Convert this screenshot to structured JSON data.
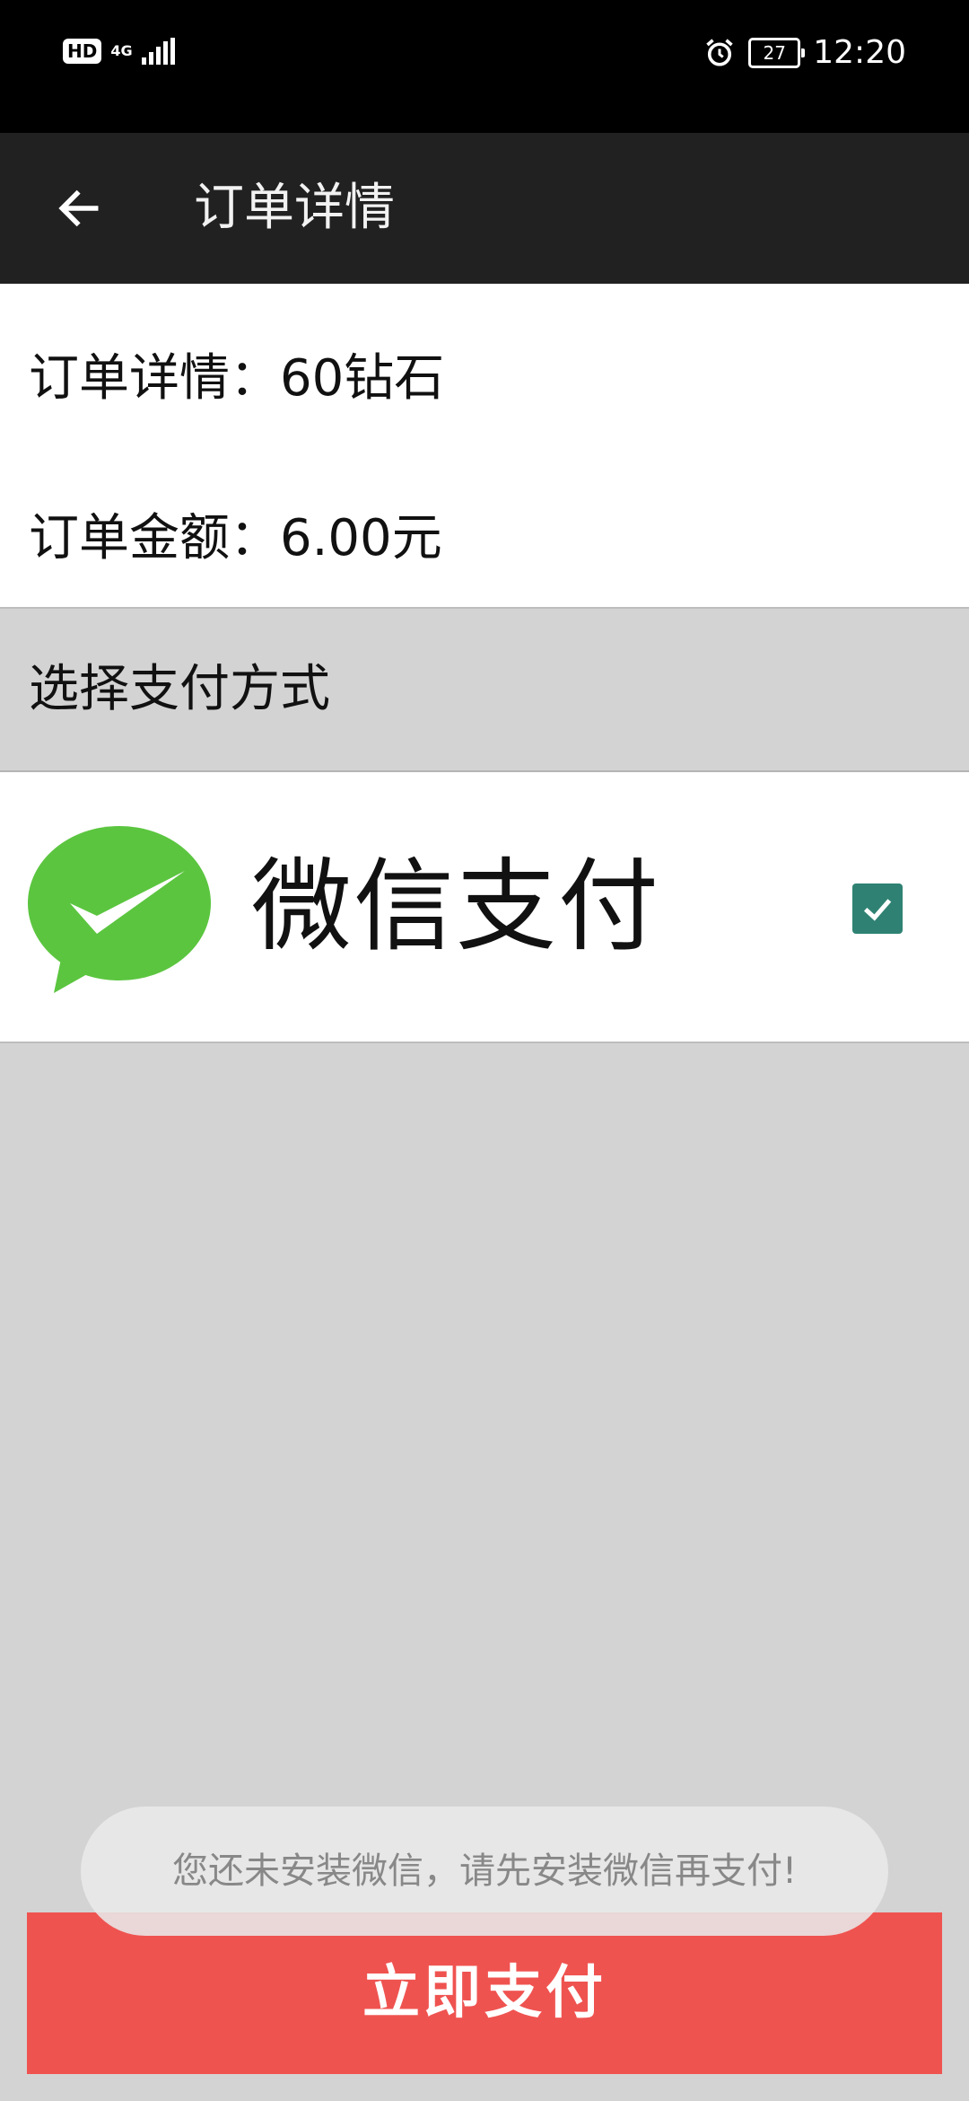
{
  "status_bar": {
    "hd_label": "HD",
    "network_label": "4G",
    "battery_level": "27",
    "time": "12:20",
    "icons": [
      "hd-icon",
      "signal-icon",
      "alarm-icon",
      "battery-icon"
    ]
  },
  "toolbar": {
    "title": "订单详情",
    "back_icon": "arrow-left-icon"
  },
  "order": {
    "details": "订单详情：60钻石",
    "amount": "订单金额：6.00元"
  },
  "payment": {
    "header": "选择支付方式",
    "wechat_label": "微信支付",
    "wechat_icon": "wechat-logo-icon",
    "wechat_checked": true
  },
  "toast": {
    "message": "您还未安装微信，请先安装微信再支付!"
  },
  "actions": {
    "pay_label": "立即支付"
  },
  "colors": {
    "status_bar": "#000000",
    "toolbar": "#212121",
    "background": "#d3d3d3",
    "wechat_green": "#5bc53f",
    "checkbox": "#2f8273",
    "pay_button": "#ef5350"
  }
}
